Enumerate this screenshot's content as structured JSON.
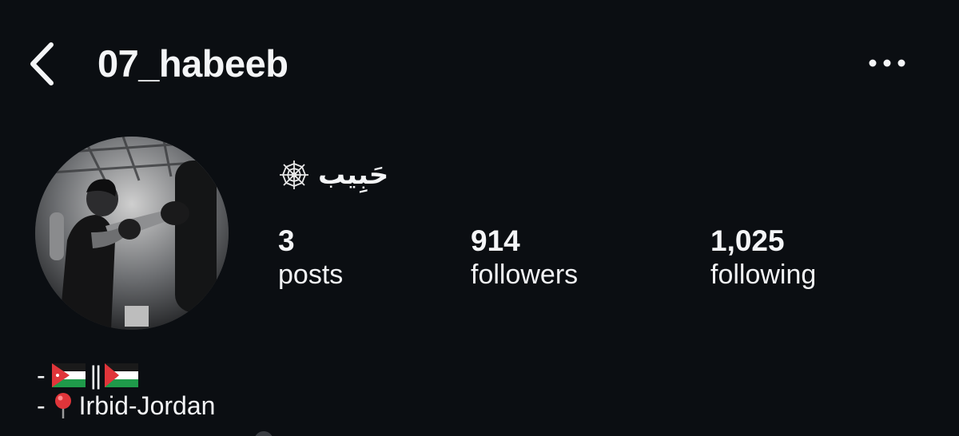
{
  "header": {
    "username": "07_habeeb",
    "back_icon": "chevron-left-icon",
    "more_icon": "ellipsis-horizontal-icon"
  },
  "profile": {
    "display_name": "حَبِيب",
    "display_icon": "spider-web-icon"
  },
  "stats": {
    "posts": {
      "count": "3",
      "label": "posts"
    },
    "followers": {
      "count": "914",
      "label": "followers"
    },
    "following": {
      "count": "1,025",
      "label": "following"
    }
  },
  "bio": {
    "line1": {
      "prefix": "-",
      "separator": "||",
      "flags": [
        "jordan-flag-icon",
        "palestine-flag-icon"
      ]
    },
    "line2": {
      "prefix": "-",
      "location": "Irbid-Jordan",
      "icon": "round-pushpin-icon"
    }
  },
  "colors": {
    "background": "#0b0e12",
    "text": "#f4f5f7",
    "pin": "#e0353a"
  }
}
